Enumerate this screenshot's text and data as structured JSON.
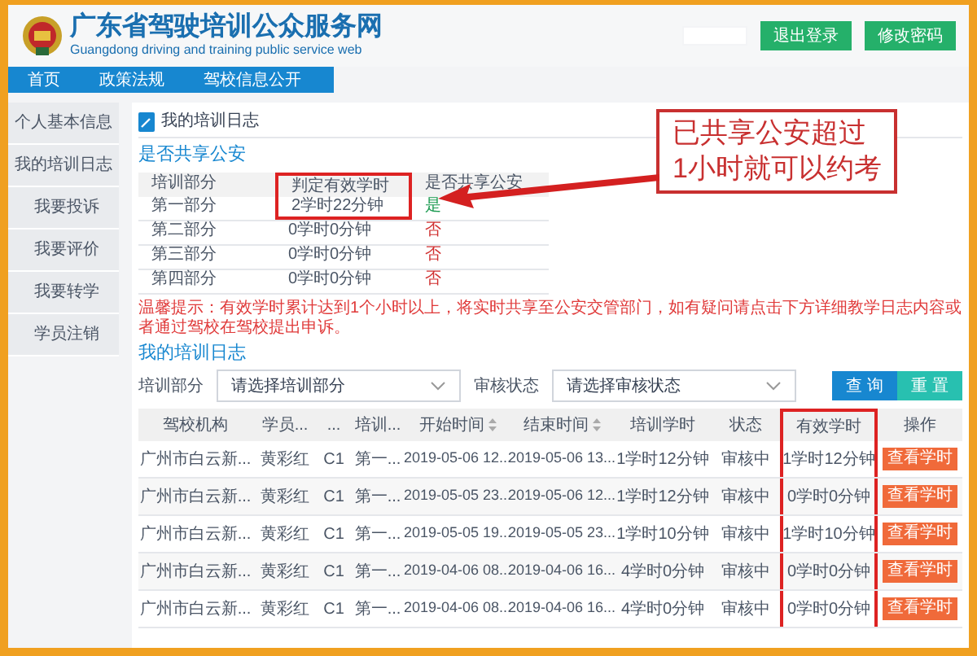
{
  "header": {
    "title": "广东省驾驶培训公众服务网",
    "subtitle": "Guangdong driving and training public service web",
    "buttons": [
      "退出登录",
      "修改密码"
    ]
  },
  "nav": [
    "首页",
    "政策法规",
    "驾校信息公开"
  ],
  "sidebar": {
    "items": [
      {
        "label": "个人基本信息"
      },
      {
        "label": "我的培训日志",
        "children": [
          {
            "label": "我要投诉"
          },
          {
            "label": "我要评价"
          },
          {
            "label": "我要转学"
          },
          {
            "label": "学员注销"
          }
        ]
      }
    ]
  },
  "page_title": "我的培训日志",
  "share_section": {
    "title": "是否共享公安",
    "columns": [
      {
        "label": "培训部分",
        "highlighted": false
      },
      {
        "label": "判定有效学时",
        "highlighted": true
      },
      {
        "label": "是否共享公安",
        "highlighted": false
      }
    ],
    "rows": [
      {
        "part": "第一部分",
        "hours": "2学时22分钟",
        "shared_label": "是",
        "shared": true,
        "highlighted": true
      },
      {
        "part": "第二部分",
        "hours": "0学时0分钟",
        "shared_label": "否",
        "shared": false,
        "highlighted": false
      },
      {
        "part": "第三部分",
        "hours": "0学时0分钟",
        "shared_label": "否",
        "shared": false,
        "highlighted": false
      },
      {
        "part": "第四部分",
        "hours": "0学时0分钟",
        "shared_label": "否",
        "shared": false,
        "highlighted": false
      }
    ]
  },
  "notice": "温馨提示：有效学时累计达到1个小时以上，将实时共享至公安交管部门，如有疑问请点击下方详细教学日志内容或者通过驾校在驾校提出申诉。",
  "annotation": {
    "lines": [
      "已共享公安超过",
      "1小时就可以约考"
    ]
  },
  "log_section": {
    "title": "我的培训日志",
    "filters": [
      {
        "label": "培训部分",
        "placeholder": "请选择培训部分"
      },
      {
        "label": "审核状态",
        "placeholder": "请选择审核状态"
      }
    ],
    "buttons": [
      {
        "label": "查 询",
        "kind": "primary"
      },
      {
        "label": "重 置",
        "kind": "secondary"
      }
    ],
    "columns": [
      {
        "label": "驾校机构",
        "sortable": false,
        "highlighted": false
      },
      {
        "label": "学员...",
        "sortable": false,
        "highlighted": false
      },
      {
        "label": "...",
        "sortable": false,
        "highlighted": false
      },
      {
        "label": "培训...",
        "sortable": false,
        "highlighted": false
      },
      {
        "label": "开始时间",
        "sortable": true,
        "highlighted": false
      },
      {
        "label": "结束时间",
        "sortable": true,
        "highlighted": false
      },
      {
        "label": "培训学时",
        "sortable": false,
        "highlighted": false
      },
      {
        "label": "状态",
        "sortable": false,
        "highlighted": false
      },
      {
        "label": "有效学时",
        "sortable": false,
        "highlighted": true
      },
      {
        "label": "操作",
        "sortable": false,
        "highlighted": false
      }
    ],
    "rows": [
      {
        "cells": [
          "广州市白云新...",
          "黄彩红",
          "C1",
          "第一...",
          "2019-05-06 12...",
          "2019-05-06 13...",
          "1学时12分钟",
          "审核中",
          "1学时12分钟"
        ],
        "action": "查看学时"
      },
      {
        "cells": [
          "广州市白云新...",
          "黄彩红",
          "C1",
          "第一...",
          "2019-05-05 23...",
          "2019-05-06 12...",
          "1学时12分钟",
          "审核中",
          "0学时0分钟"
        ],
        "action": "查看学时"
      },
      {
        "cells": [
          "广州市白云新...",
          "黄彩红",
          "C1",
          "第一...",
          "2019-05-05 19...",
          "2019-05-05 23...",
          "1学时10分钟",
          "审核中",
          "1学时10分钟"
        ],
        "action": "查看学时"
      },
      {
        "cells": [
          "广州市白云新...",
          "黄彩红",
          "C1",
          "第一...",
          "2019-04-06 08...",
          "2019-04-06 16...",
          "4学时0分钟",
          "审核中",
          "0学时0分钟"
        ],
        "action": "查看学时"
      },
      {
        "cells": [
          "广州市白云新...",
          "黄彩红",
          "C1",
          "第一...",
          "2019-04-06 08...",
          "2019-04-06 16...",
          "4学时0分钟",
          "审核中",
          "0学时0分钟"
        ],
        "action": "查看学时"
      }
    ]
  }
}
